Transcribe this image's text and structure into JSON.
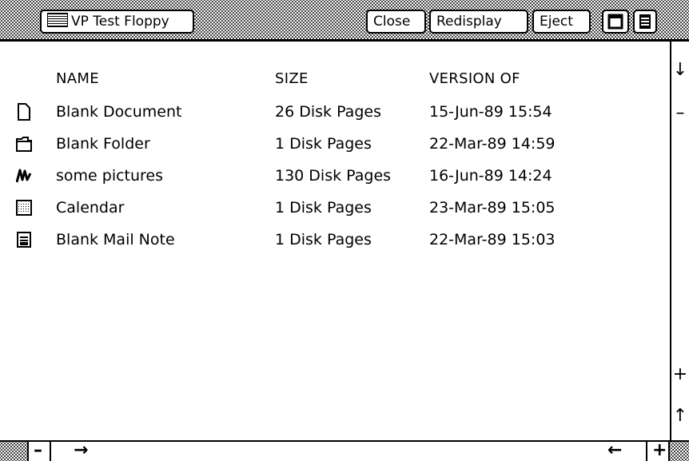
{
  "window": {
    "title": "VP Test Floppy",
    "buttons": {
      "close": "Close",
      "redisplay": "Redisplay",
      "eject": "Eject"
    }
  },
  "table": {
    "columns": [
      "NAME",
      "SIZE",
      "VERSION OF"
    ],
    "rows": [
      {
        "icon": "document-icon",
        "name": "Blank Document",
        "size": "26 Disk Pages",
        "version": "15-Jun-89 15:54"
      },
      {
        "icon": "folder-icon",
        "name": "Blank Folder",
        "size": "1 Disk Pages",
        "version": "22-Mar-89 14:59"
      },
      {
        "icon": "drawing-icon",
        "name": "some pictures",
        "size": "130 Disk Pages",
        "version": "16-Jun-89 14:24"
      },
      {
        "icon": "calendar-icon",
        "name": "Calendar",
        "size": "1 Disk Pages",
        "version": "23-Mar-89 15:05"
      },
      {
        "icon": "mail-note-icon",
        "name": "Blank Mail Note",
        "size": "1 Disk Pages",
        "version": "22-Mar-89 15:03"
      }
    ]
  },
  "scrollbar": {
    "vertical": {
      "down": "↓",
      "minus": "–",
      "plus": "+",
      "up": "↑"
    },
    "horizontal": {
      "minus": "–",
      "right": "→",
      "left": "←",
      "plus": "+"
    }
  }
}
